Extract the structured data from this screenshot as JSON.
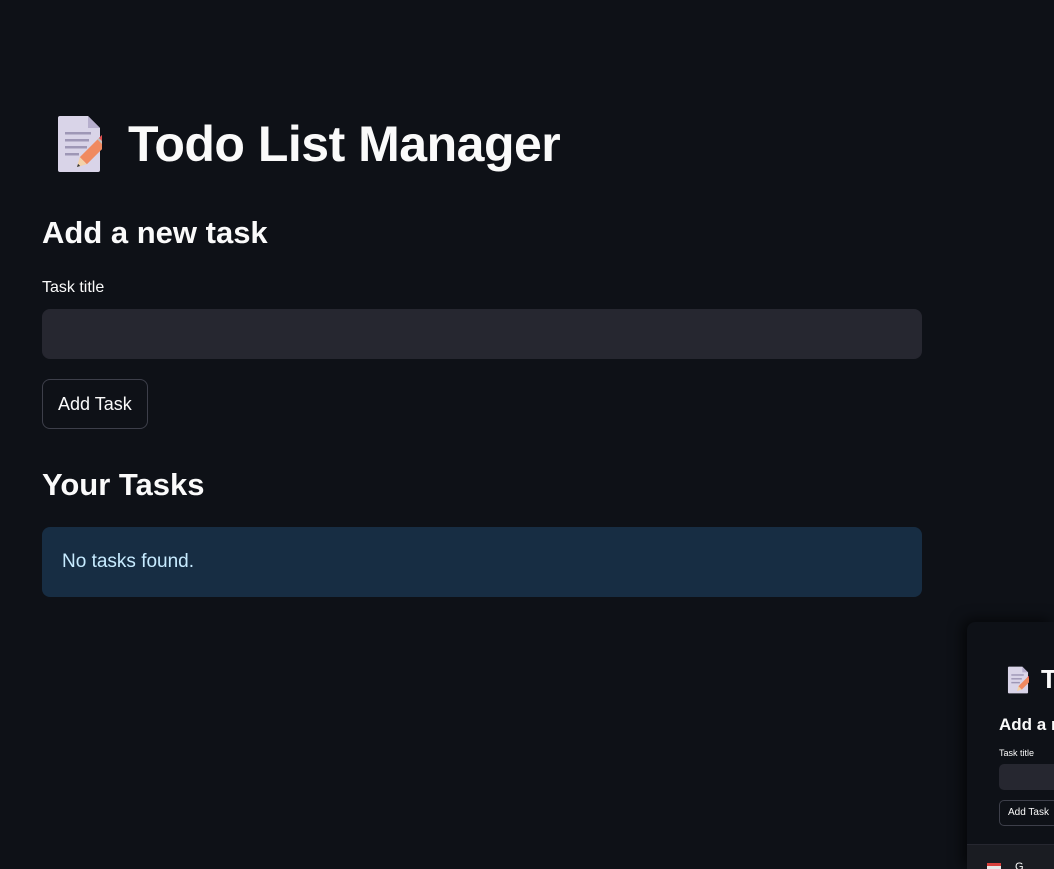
{
  "app": {
    "title": "Todo List Manager",
    "title_icon": "memo-icon"
  },
  "add_section": {
    "heading": "Add a new task",
    "field_label": "Task title",
    "input_value": "",
    "button_label": "Add Task"
  },
  "tasks_section": {
    "heading": "Your Tasks",
    "empty_message": "No tasks found."
  },
  "preview": {
    "title": "To",
    "heading": "Add a n",
    "field_label": "Task title",
    "button_label": "Add Task",
    "footer_text": "G"
  },
  "colors": {
    "background": "#0e1117",
    "input_background": "#262730",
    "info_background": "#172d43",
    "info_text": "#c7ebff",
    "text": "#fafafa"
  }
}
